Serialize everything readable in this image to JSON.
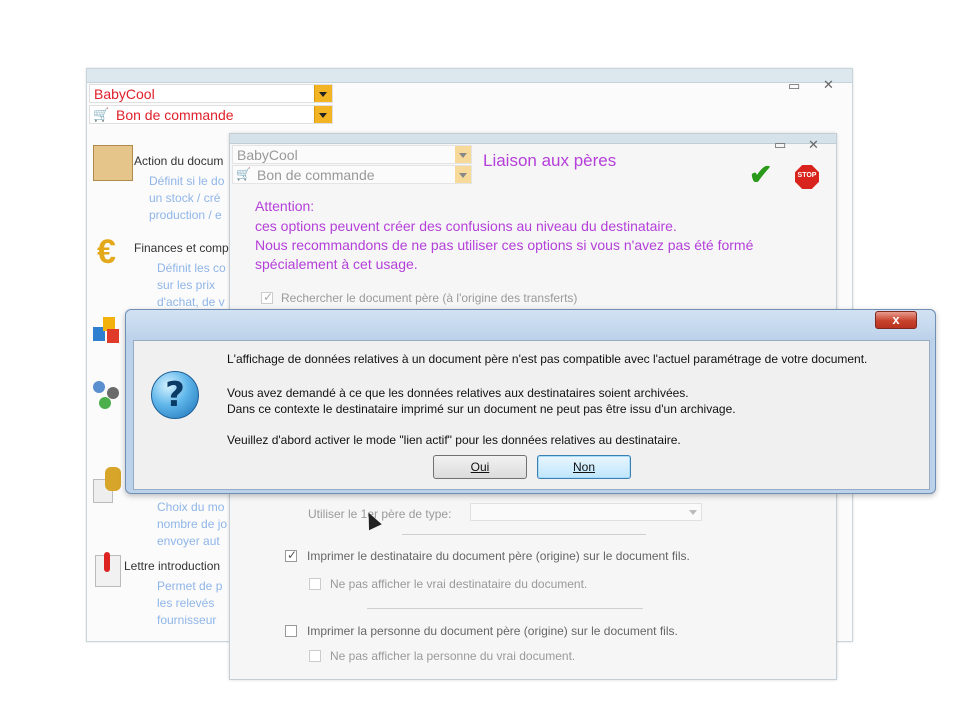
{
  "main_window": {
    "company": "BabyCool",
    "doc_type": "Bon de commande",
    "sections": [
      {
        "label": "Action du docum",
        "desc": [
          "Définit si le do",
          "un stock / cré",
          "production / e"
        ]
      },
      {
        "label": "Finances et comp",
        "desc": [
          "Définit les co",
          "sur les prix",
          "d'achat, de v"
        ]
      },
      {
        "label": "",
        "desc": [
          "Choix du mo",
          "nombre de jo",
          "envoyer aut"
        ]
      },
      {
        "label": "Lettre introduction",
        "desc": [
          "Permet de p",
          "les relevés",
          "fournisseur"
        ]
      }
    ],
    "icons": {
      "section1": "shelf-icon",
      "section2": "euro-icon",
      "section3": "blocks-icon",
      "section4": "network-icon",
      "section5": "money-icon",
      "section6": "letter-icon"
    }
  },
  "liaison_window": {
    "company": "BabyCool",
    "doc_type": "Bon de commande",
    "title": "Liaison aux pères",
    "attention_title": "Attention:",
    "attention_lines": [
      "ces options peuvent créer des confusions au niveau du destinataire.",
      "Nous recommandons de ne pas utiliser ces options si vous n'avez pas été formé",
      "spécialement à cet usage."
    ],
    "opt_search_parent": "Rechercher le document père (à l'origine des transferts)",
    "opt_use_parent_type": "Utiliser le 1er père de type:",
    "opt_print_recipient": "Imprimer le destinataire du document père (origine) sur le document fils.",
    "opt_hide_recipient": "Ne pas afficher le vrai destinataire du document.",
    "opt_print_person": "Imprimer la personne du document père (origine) sur le document fils.",
    "opt_hide_person": "Ne pas afficher la personne du vrai document."
  },
  "dialog": {
    "close_label": "x",
    "icon": "question-icon",
    "lines": [
      "L'affichage de données relatives à un document père n'est pas compatible avec l'actuel paramétrage de votre document.",
      "Vous avez demandé à ce que les données relatives aux destinataires soient archivées.",
      "Dans ce contexte le destinataire imprimé sur un document ne peut pas être issu d'un archivage.",
      "Veuillez d'abord activer le mode \"lien actif\" pour les données relatives au destinataire."
    ],
    "yes_label": "Oui",
    "no_label": "Non"
  },
  "colors": {
    "accent_orange": "#f3b423",
    "red": "#e0202a",
    "purple": "#b43fd9",
    "desc_blue": "#8fb5e8"
  }
}
